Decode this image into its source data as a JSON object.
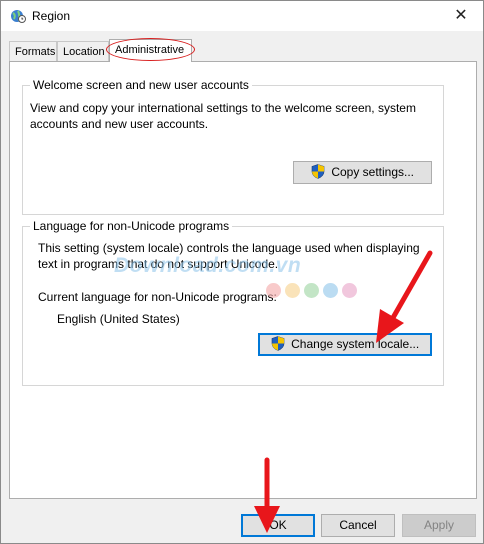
{
  "window": {
    "title": "Region",
    "close_glyph": "✕"
  },
  "tabs": [
    {
      "label": "Formats"
    },
    {
      "label": "Location"
    },
    {
      "label": "Administrative"
    }
  ],
  "welcome_group": {
    "title": "Welcome screen and new user accounts",
    "description": "View and copy your international settings to the welcome screen, system accounts and new user accounts.",
    "button_label": "Copy settings..."
  },
  "language_group": {
    "title": "Language for non-Unicode programs",
    "description": "This setting (system locale) controls the language used when displaying text in programs that do not support Unicode.",
    "current_label": "Current language for non-Unicode programs:",
    "current_value": "English (United States)",
    "button_label": "Change system locale..."
  },
  "watermark": {
    "text": "Download.com.vn"
  },
  "footer": {
    "ok_label": "OK",
    "cancel_label": "Cancel",
    "apply_label": "Apply"
  },
  "colors": {
    "accent": "#0078d7",
    "annotation": "#e8161b",
    "shield_blue": "#1f5fbf",
    "shield_yellow": "#f5c400"
  },
  "icons": {
    "app": "globe-clock-icon",
    "shield": "uac-shield-icon",
    "close": "close-icon"
  }
}
